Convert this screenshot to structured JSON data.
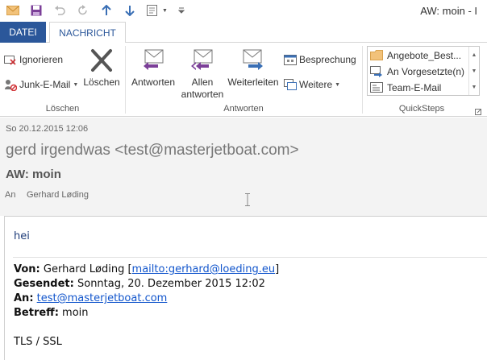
{
  "window": {
    "title": "AW: moin - I"
  },
  "tabs": {
    "file": "DATEI",
    "message": "NACHRICHT"
  },
  "ribbon": {
    "loeschen_group": {
      "ignore": "Ignorieren",
      "junk": "Junk-E-Mail",
      "delete": "Löschen",
      "label": "Löschen"
    },
    "antworten_group": {
      "reply": "Antworten",
      "reply_all_1": "Allen",
      "reply_all_2": "antworten",
      "forward": "Weiterleiten",
      "meeting": "Besprechung",
      "more": "Weitere",
      "label": "Antworten"
    },
    "quicksteps": {
      "items": [
        "Angebote_Best...",
        "An Vorgesetzte(n)",
        "Team-E-Mail"
      ],
      "label": "QuickSteps"
    }
  },
  "message": {
    "date": "So 20.12.2015 12:06",
    "sender": "gerd irgendwas <test@masterjetboat.com>",
    "subject": "AW: moin",
    "to_label": "An",
    "to_name": "Gerhard Løding"
  },
  "body": {
    "greeting": "hei",
    "from_label": "Von:",
    "from_name": "Gerhard Løding [",
    "from_link": "mailto:gerhard@loeding.eu",
    "from_end": "]",
    "sent_label": "Gesendet:",
    "sent_value": "Sonntag, 20. Dezember 2015 12:02",
    "to_label": "An:",
    "to_link": "test@masterjetboat.com",
    "subject_label": "Betreff:",
    "subject_value": "moin",
    "signature": "TLS / SSL"
  },
  "colors": {
    "accent": "#2b579a",
    "link": "#1155cc",
    "header_bg": "#f3f3f3"
  }
}
